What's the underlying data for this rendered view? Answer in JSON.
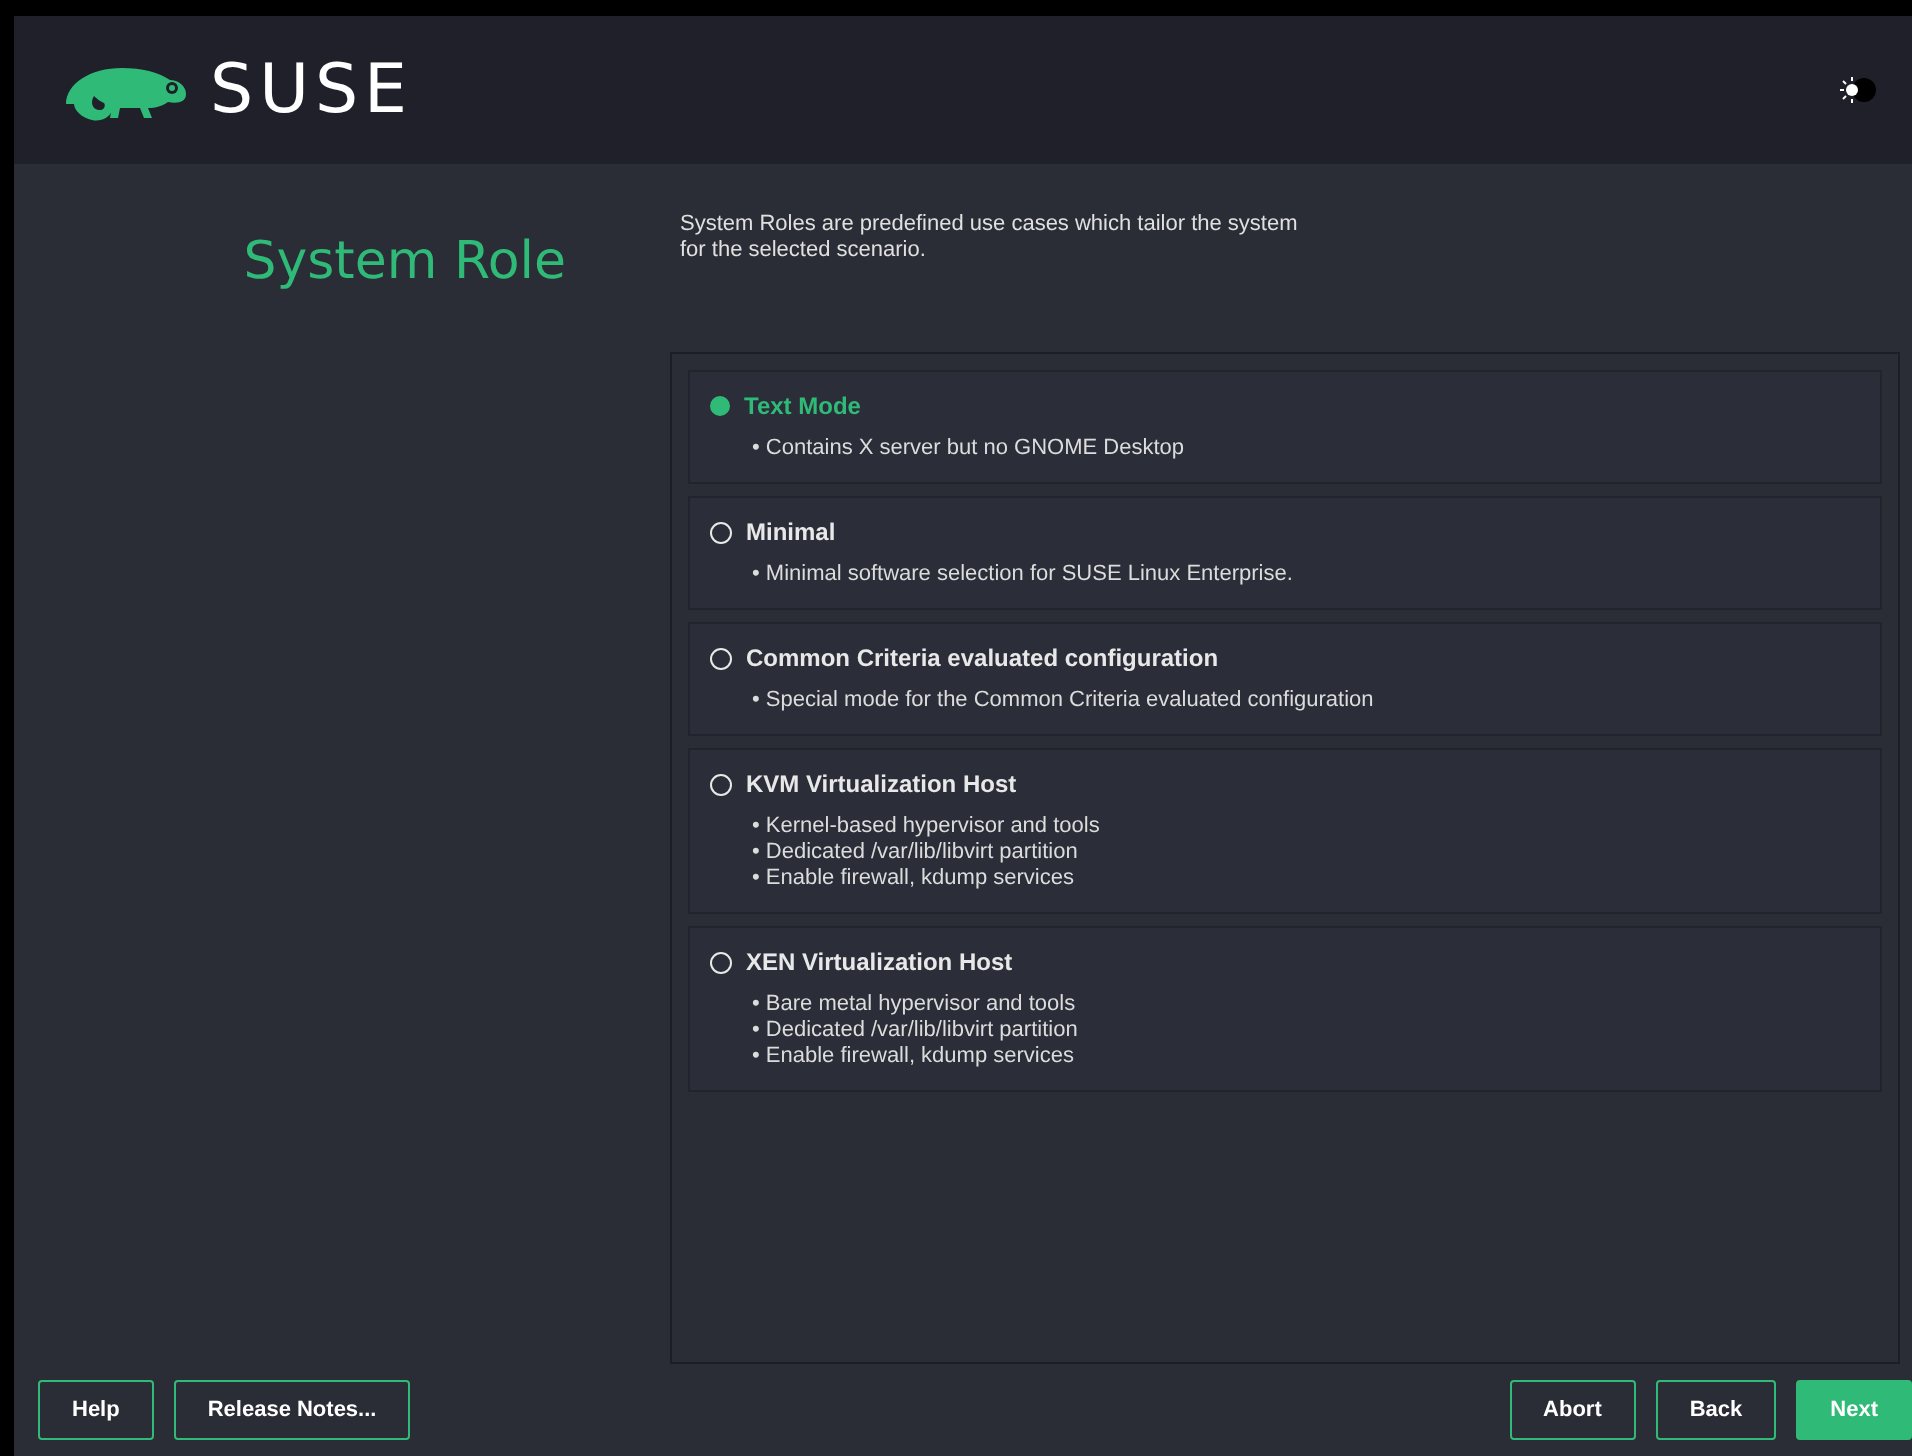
{
  "header": {
    "logo_text": "SUSE"
  },
  "page": {
    "title": "System Role",
    "description": "System Roles are predefined use cases which tailor the system\nfor the selected scenario."
  },
  "roles": [
    {
      "label": "Text Mode",
      "selected": true,
      "details": [
        "• Contains X server but no GNOME Desktop"
      ]
    },
    {
      "label": "Minimal",
      "selected": false,
      "details": [
        "• Minimal software selection for SUSE Linux Enterprise."
      ]
    },
    {
      "label": "Common Criteria evaluated configuration",
      "selected": false,
      "details": [
        "• Special mode for the Common Criteria evaluated configuration"
      ]
    },
    {
      "label": "KVM Virtualization Host",
      "selected": false,
      "details": [
        "• Kernel-based hypervisor and tools",
        "• Dedicated /var/lib/libvirt partition",
        "• Enable firewall, kdump services"
      ]
    },
    {
      "label": "XEN Virtualization Host",
      "selected": false,
      "details": [
        "• Bare metal hypervisor and tools",
        "• Dedicated /var/lib/libvirt partition",
        "• Enable firewall, kdump services"
      ]
    }
  ],
  "buttons_left": [
    {
      "label": "Help",
      "kind": "outline"
    },
    {
      "label": "Release Notes...",
      "kind": "outline"
    }
  ],
  "buttons_right": [
    {
      "label": "Abort",
      "kind": "outline"
    },
    {
      "label": "Back",
      "kind": "outline"
    },
    {
      "label": "Next",
      "kind": "primary"
    }
  ]
}
